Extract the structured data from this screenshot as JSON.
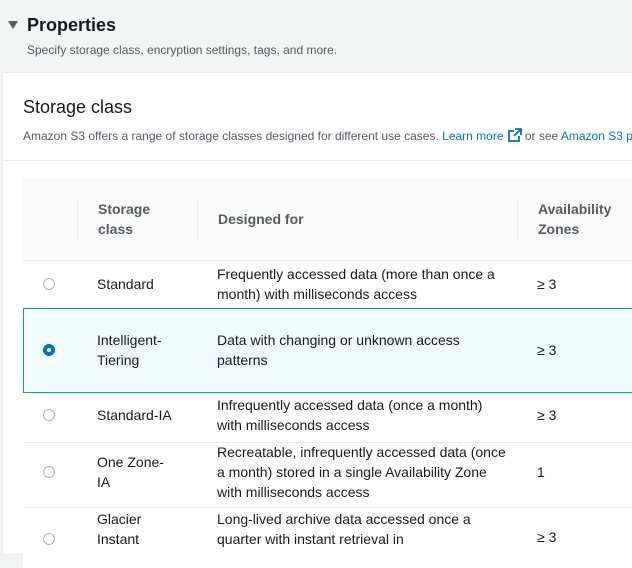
{
  "section": {
    "title": "Properties",
    "description": "Specify storage class, encryption settings, tags, and more."
  },
  "storage_class": {
    "title": "Storage class",
    "description_prefix": "Amazon S3 offers a range of storage classes designed for different use cases. ",
    "learn_more": "Learn more",
    "or_see": " or see ",
    "pricing_link": "Amazon S3 p"
  },
  "table": {
    "headers": [
      "Storage class",
      "Designed for",
      "Availability Zones"
    ],
    "rows": [
      {
        "class": "Standard",
        "designed_for": "Frequently accessed data (more than once a month) with milliseconds access",
        "az": "≥ 3",
        "selected": false
      },
      {
        "class": "Intelligent-Tiering",
        "designed_for": "Data with changing or unknown access patterns",
        "az": "≥ 3",
        "selected": true
      },
      {
        "class": "Standard-IA",
        "designed_for": "Infrequently accessed data (once a month) with milliseconds access",
        "az": "≥ 3",
        "selected": false
      },
      {
        "class": "One Zone-IA",
        "designed_for": "Recreatable, infrequently accessed data (once a month) stored in a single Availability Zone with milliseconds access",
        "az": "1",
        "selected": false
      },
      {
        "class": "Glacier Instant",
        "designed_for": "Long-lived archive data accessed once a quarter with instant retrieval in",
        "az": "≥ 3",
        "selected": false
      }
    ]
  },
  "colors": {
    "link": "#0073bb",
    "selected_border": "#00a1c9",
    "selected_bg": "#f1faff"
  }
}
